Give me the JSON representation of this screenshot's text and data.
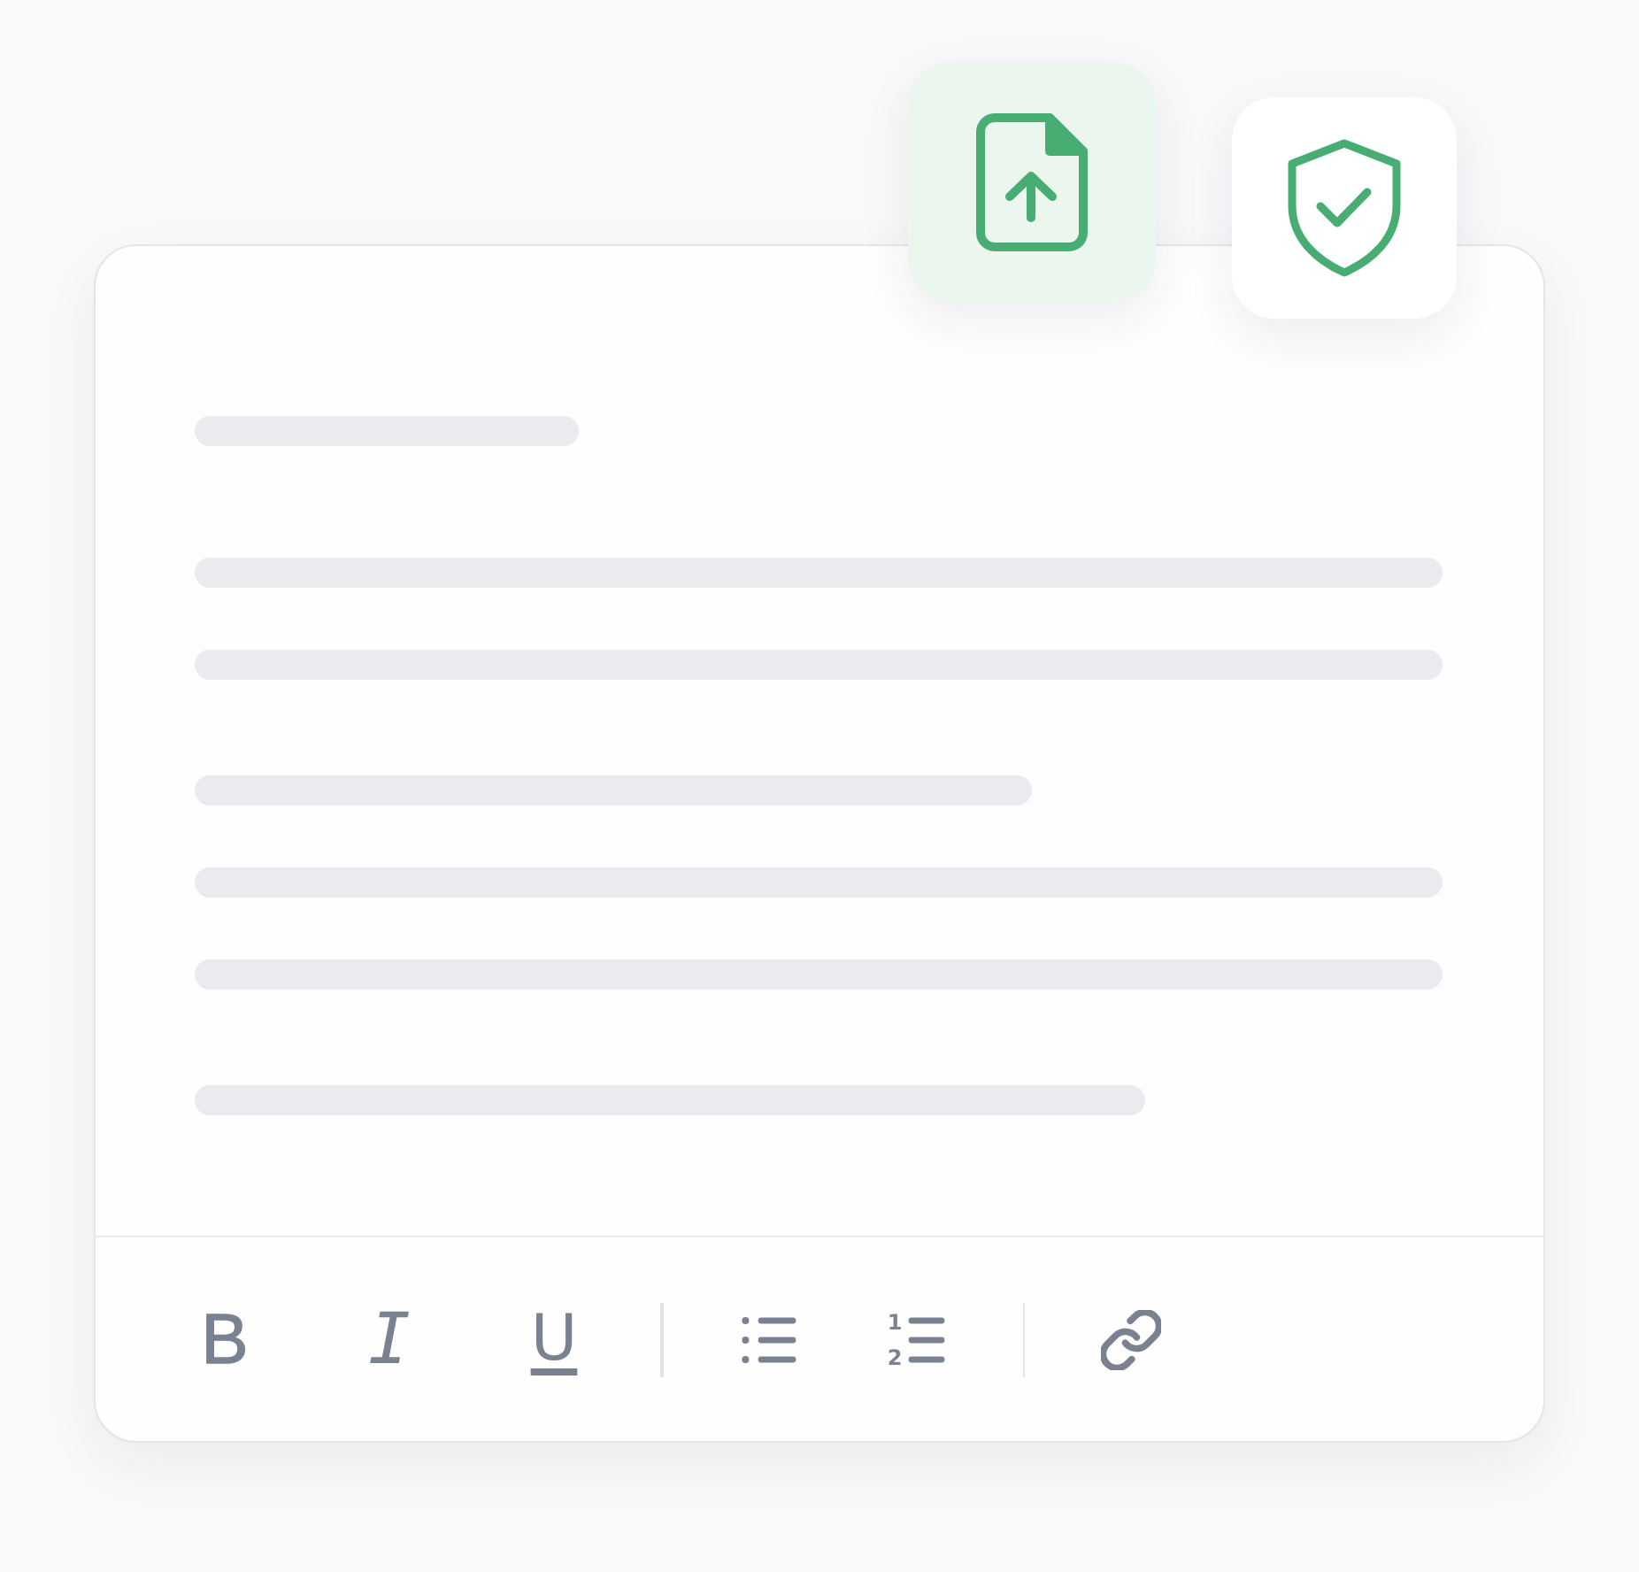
{
  "badges": [
    {
      "kind": "file-upload",
      "highlighted": true
    },
    {
      "kind": "shield-check",
      "highlighted": false
    }
  ],
  "editor": {
    "heading_line": {
      "kind": "short"
    },
    "paragraphs": [
      {
        "lines": [
          {
            "kind": "full"
          },
          {
            "kind": "full"
          }
        ]
      },
      {
        "lines": [
          {
            "kind": "long"
          },
          {
            "kind": "full"
          },
          {
            "kind": "full"
          }
        ]
      },
      {
        "lines": [
          {
            "kind": "most"
          }
        ]
      }
    ]
  },
  "toolbar": {
    "groups": [
      {
        "tools": [
          {
            "kind": "bold",
            "label": "B"
          },
          {
            "kind": "italic",
            "label": "I"
          },
          {
            "kind": "underline",
            "label": "U"
          }
        ]
      },
      {
        "tools": [
          {
            "kind": "bullets"
          },
          {
            "kind": "numbers",
            "markers": [
              "1",
              "2"
            ]
          }
        ]
      },
      {
        "tools": [
          {
            "kind": "link"
          }
        ]
      }
    ]
  }
}
